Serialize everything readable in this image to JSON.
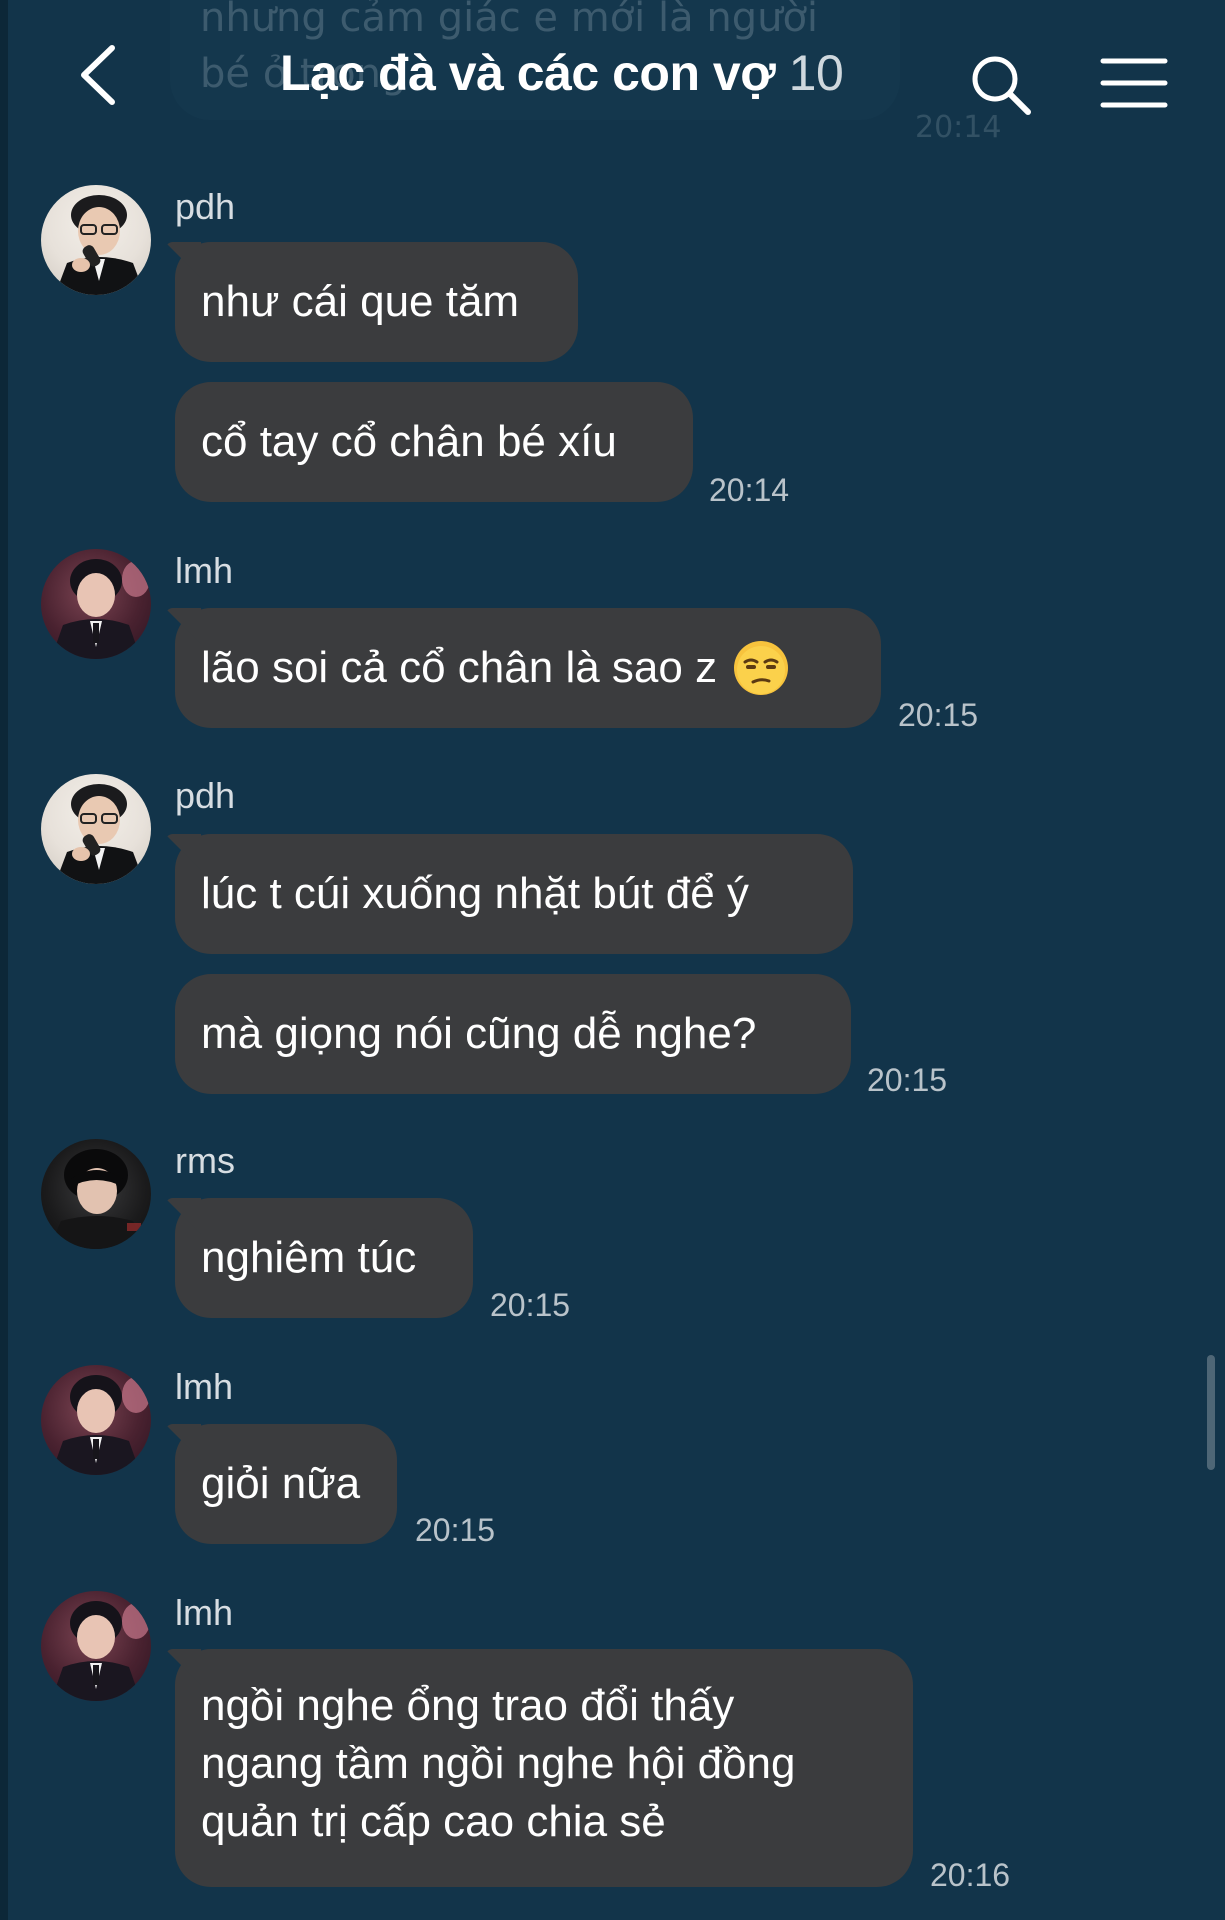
{
  "header": {
    "title": "Lạc đà và các con vợ",
    "member_count": "10",
    "back_icon": "chevron-left-icon",
    "search_icon": "search-icon",
    "menu_icon": "hamburger-menu-icon"
  },
  "ghost_message": {
    "line1": "nhưng cảm giác e mới là người",
    "line2": "bé ở trong",
    "time": "20:14"
  },
  "messages": [
    {
      "sender": "pdh",
      "bubbles": [
        "như cái que tăm",
        "cổ tay cổ chân bé xíu"
      ],
      "time": "20:14"
    },
    {
      "sender": "lmh",
      "bubbles": [
        "lão soi cả cổ chân là sao z"
      ],
      "emoji": "unamused-face",
      "time": "20:15"
    },
    {
      "sender": "pdh",
      "bubbles": [
        "lúc t cúi xuống nhặt bút để ý",
        "mà giọng nói cũng dễ nghe?"
      ],
      "time": "20:15"
    },
    {
      "sender": "rms",
      "bubbles": [
        "nghiêm túc"
      ],
      "time": "20:15"
    },
    {
      "sender": "lmh",
      "bubbles": [
        "giỏi nữa"
      ],
      "time": "20:15"
    },
    {
      "sender": "lmh",
      "bubbles": [
        "ngồi nghe ổng trao đổi thấy",
        "ngang tầm ngồi nghe hội đồng",
        "quản trị cấp cao chia sẻ"
      ],
      "time": "20:16"
    }
  ],
  "colors": {
    "background": "#12344a",
    "bubble": "#3b3c3e",
    "text": "#ffffff",
    "timestamp": "#b9c3ca"
  }
}
